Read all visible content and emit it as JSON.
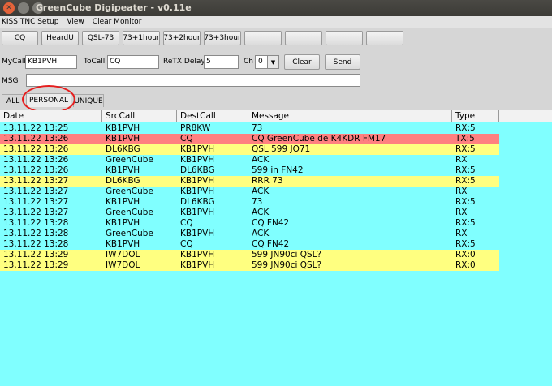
{
  "window": {
    "title": "GreenCube Digipeater - v0.11e"
  },
  "menu": [
    "KISS TNC Setup",
    "View",
    "Clear Monitor"
  ],
  "quick_buttons": [
    "CQ",
    "HeardU",
    "QSL-73",
    "73+1hour",
    "73+2hour",
    "73+3hour",
    "",
    "",
    "",
    ""
  ],
  "form": {
    "mycall_label": "MyCall",
    "mycall_value": "KB1PVH",
    "tocall_label": "ToCall",
    "tocall_value": "CQ",
    "retx_label": "ReTX Delay",
    "retx_value": "5",
    "ch_label": "Ch",
    "ch_value": "0",
    "clear_label": "Clear",
    "send_label": "Send",
    "msg_label": "MSG",
    "msg_value": ""
  },
  "tabs": [
    {
      "label": "ALL",
      "active": false
    },
    {
      "label": "PERSONAL",
      "active": true
    },
    {
      "label": "UNIQUE",
      "active": false
    }
  ],
  "table": {
    "columns": [
      "Date",
      "SrcCall",
      "DestCall",
      "Message",
      "Type"
    ],
    "rows": [
      {
        "date": "13.11.22 13:25",
        "src": "KB1PVH",
        "dest": "PR8KW",
        "msg": "73",
        "type": "RX:5",
        "color": "#80ffff"
      },
      {
        "date": "13.11.22 13:26",
        "src": "KB1PVH",
        "dest": "CQ",
        "msg": "CQ GreenCube de K4KDR FM17",
        "type": "TX:5",
        "color": "#ff8080"
      },
      {
        "date": "13.11.22 13:26",
        "src": "DL6KBG",
        "dest": "KB1PVH",
        "msg": "QSL 599 JO71",
        "type": "RX:5",
        "color": "#ffff80"
      },
      {
        "date": "13.11.22 13:26",
        "src": "GreenCube",
        "dest": "KB1PVH",
        "msg": "ACK",
        "type": "RX",
        "color": "#80ffff"
      },
      {
        "date": "13.11.22 13:26",
        "src": "KB1PVH",
        "dest": "DL6KBG",
        "msg": "599 in FN42",
        "type": "RX:5",
        "color": "#80ffff"
      },
      {
        "date": "13.11.22 13:27",
        "src": "DL6KBG",
        "dest": "KB1PVH",
        "msg": "RRR 73",
        "type": "RX:5",
        "color": "#ffff80"
      },
      {
        "date": "13.11.22 13:27",
        "src": "GreenCube",
        "dest": "KB1PVH",
        "msg": "ACK",
        "type": "RX",
        "color": "#80ffff"
      },
      {
        "date": "13.11.22 13:27",
        "src": "KB1PVH",
        "dest": "DL6KBG",
        "msg": "73",
        "type": "RX:5",
        "color": "#80ffff"
      },
      {
        "date": "13.11.22 13:27",
        "src": "GreenCube",
        "dest": "KB1PVH",
        "msg": "ACK",
        "type": "RX",
        "color": "#80ffff"
      },
      {
        "date": "13.11.22 13:28",
        "src": "KB1PVH",
        "dest": "CQ",
        "msg": "CQ FN42",
        "type": "RX:5",
        "color": "#80ffff"
      },
      {
        "date": "13.11.22 13:28",
        "src": "GreenCube",
        "dest": "KB1PVH",
        "msg": "ACK",
        "type": "RX",
        "color": "#80ffff"
      },
      {
        "date": "13.11.22 13:28",
        "src": "KB1PVH",
        "dest": "CQ",
        "msg": "CQ FN42",
        "type": "RX:5",
        "color": "#80ffff"
      },
      {
        "date": "13.11.22 13:29",
        "src": "IW7DOL",
        "dest": "KB1PVH",
        "msg": "599 JN90ci QSL?",
        "type": "RX:0",
        "color": "#ffff80"
      },
      {
        "date": "13.11.22 13:29",
        "src": "IW7DOL",
        "dest": "KB1PVH",
        "msg": "599 JN90ci QSL?",
        "type": "RX:0",
        "color": "#ffff80"
      }
    ]
  }
}
